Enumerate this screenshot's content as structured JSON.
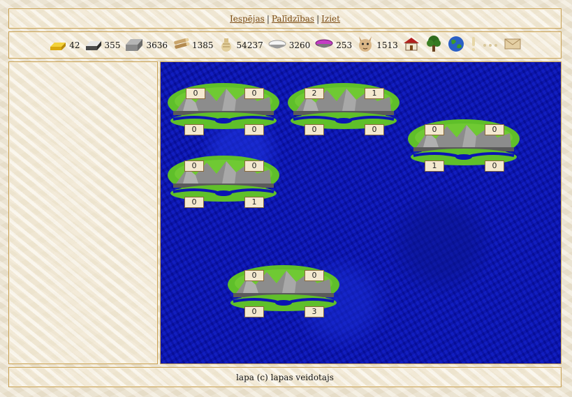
{
  "nav": {
    "links": [
      "Iespējas",
      "Palīdzības",
      "Iziet"
    ],
    "separator": "|"
  },
  "resources": [
    {
      "icon": "gold-bar-icon",
      "value": "42"
    },
    {
      "icon": "iron-ingot-icon",
      "value": "355"
    },
    {
      "icon": "stone-block-icon",
      "value": "3636"
    },
    {
      "icon": "wood-logs-icon",
      "value": "1385"
    },
    {
      "icon": "wheat-sack-icon",
      "value": "54237"
    },
    {
      "icon": "flour-bowl-icon",
      "value": "3260"
    },
    {
      "icon": "purple-dye-bowl-icon",
      "value": "253"
    },
    {
      "icon": "population-face-icon",
      "value": "1513"
    }
  ],
  "nav_icons": [
    "house-icon",
    "tree-icon",
    "globe-icon",
    "exclamation-icon",
    "ellipsis-icon",
    "envelope-icon"
  ],
  "islands": [
    {
      "top_left": "0",
      "top_right": "0",
      "bottom_left": "0",
      "bottom_right": "0"
    },
    {
      "top_left": "2",
      "top_right": "1",
      "bottom_left": "0",
      "bottom_right": "0"
    },
    {
      "top_left": "0",
      "top_right": "0",
      "bottom_left": "1",
      "bottom_right": "0"
    },
    {
      "top_left": "0",
      "top_right": "0",
      "bottom_left": "0",
      "bottom_right": "1"
    },
    {
      "top_left": "0",
      "top_right": "0",
      "bottom_left": "0",
      "bottom_right": "3"
    }
  ],
  "colors": {
    "sea": "#0a14b4",
    "grass": "#5fbf2a",
    "mountain": "#8c8c8c",
    "link": "#7a4a12",
    "border": "#c8a052"
  },
  "footer": {
    "text": "lapa (c) lapas veidotajs"
  }
}
